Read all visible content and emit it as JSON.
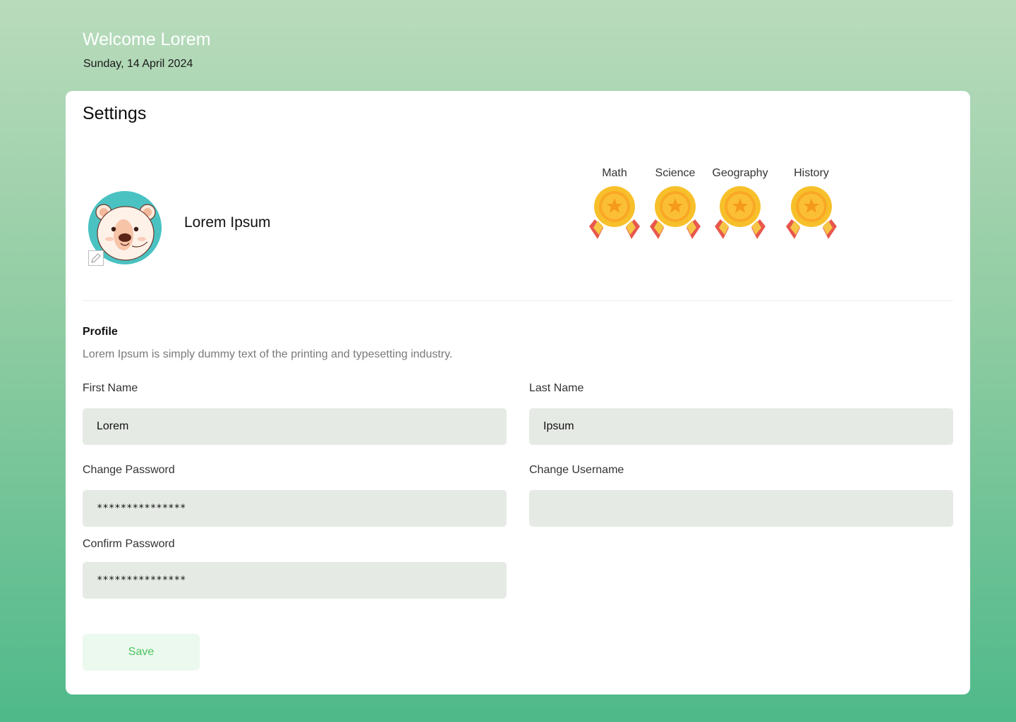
{
  "header": {
    "welcome": "Welcome Lorem",
    "date": "Sunday, 14 April 2024"
  },
  "settings": {
    "title": "Settings",
    "user": {
      "name": "Lorem Ipsum",
      "avatar_icon": "polar-bear-avatar",
      "edit_icon": "pencil-icon"
    },
    "badges": [
      {
        "label": "Math",
        "icon": "medal-icon"
      },
      {
        "label": "Science",
        "icon": "medal-icon"
      },
      {
        "label": "Geography",
        "icon": "medal-icon"
      },
      {
        "label": "History",
        "icon": "medal-icon"
      }
    ],
    "profile": {
      "title": "Profile",
      "description": "Lorem Ipsum is simply dummy text of the printing and typesetting industry."
    },
    "fields": {
      "first_name": {
        "label": "First Name",
        "value": "Lorem"
      },
      "last_name": {
        "label": "Last Name",
        "value": "Ipsum"
      },
      "change_password": {
        "label": "Change Password",
        "value": "***************"
      },
      "change_username": {
        "label": "Change Username",
        "value": ""
      },
      "confirm_password": {
        "label": "Confirm Password",
        "value": "***************"
      }
    },
    "save_label": "Save"
  },
  "colors": {
    "accent": "#4cc45f",
    "field_bg": "#e6eae5",
    "avatar_bg": "#4ac2c2",
    "medal_gold": "#f7c02b",
    "ribbon_red": "#e8574d"
  }
}
